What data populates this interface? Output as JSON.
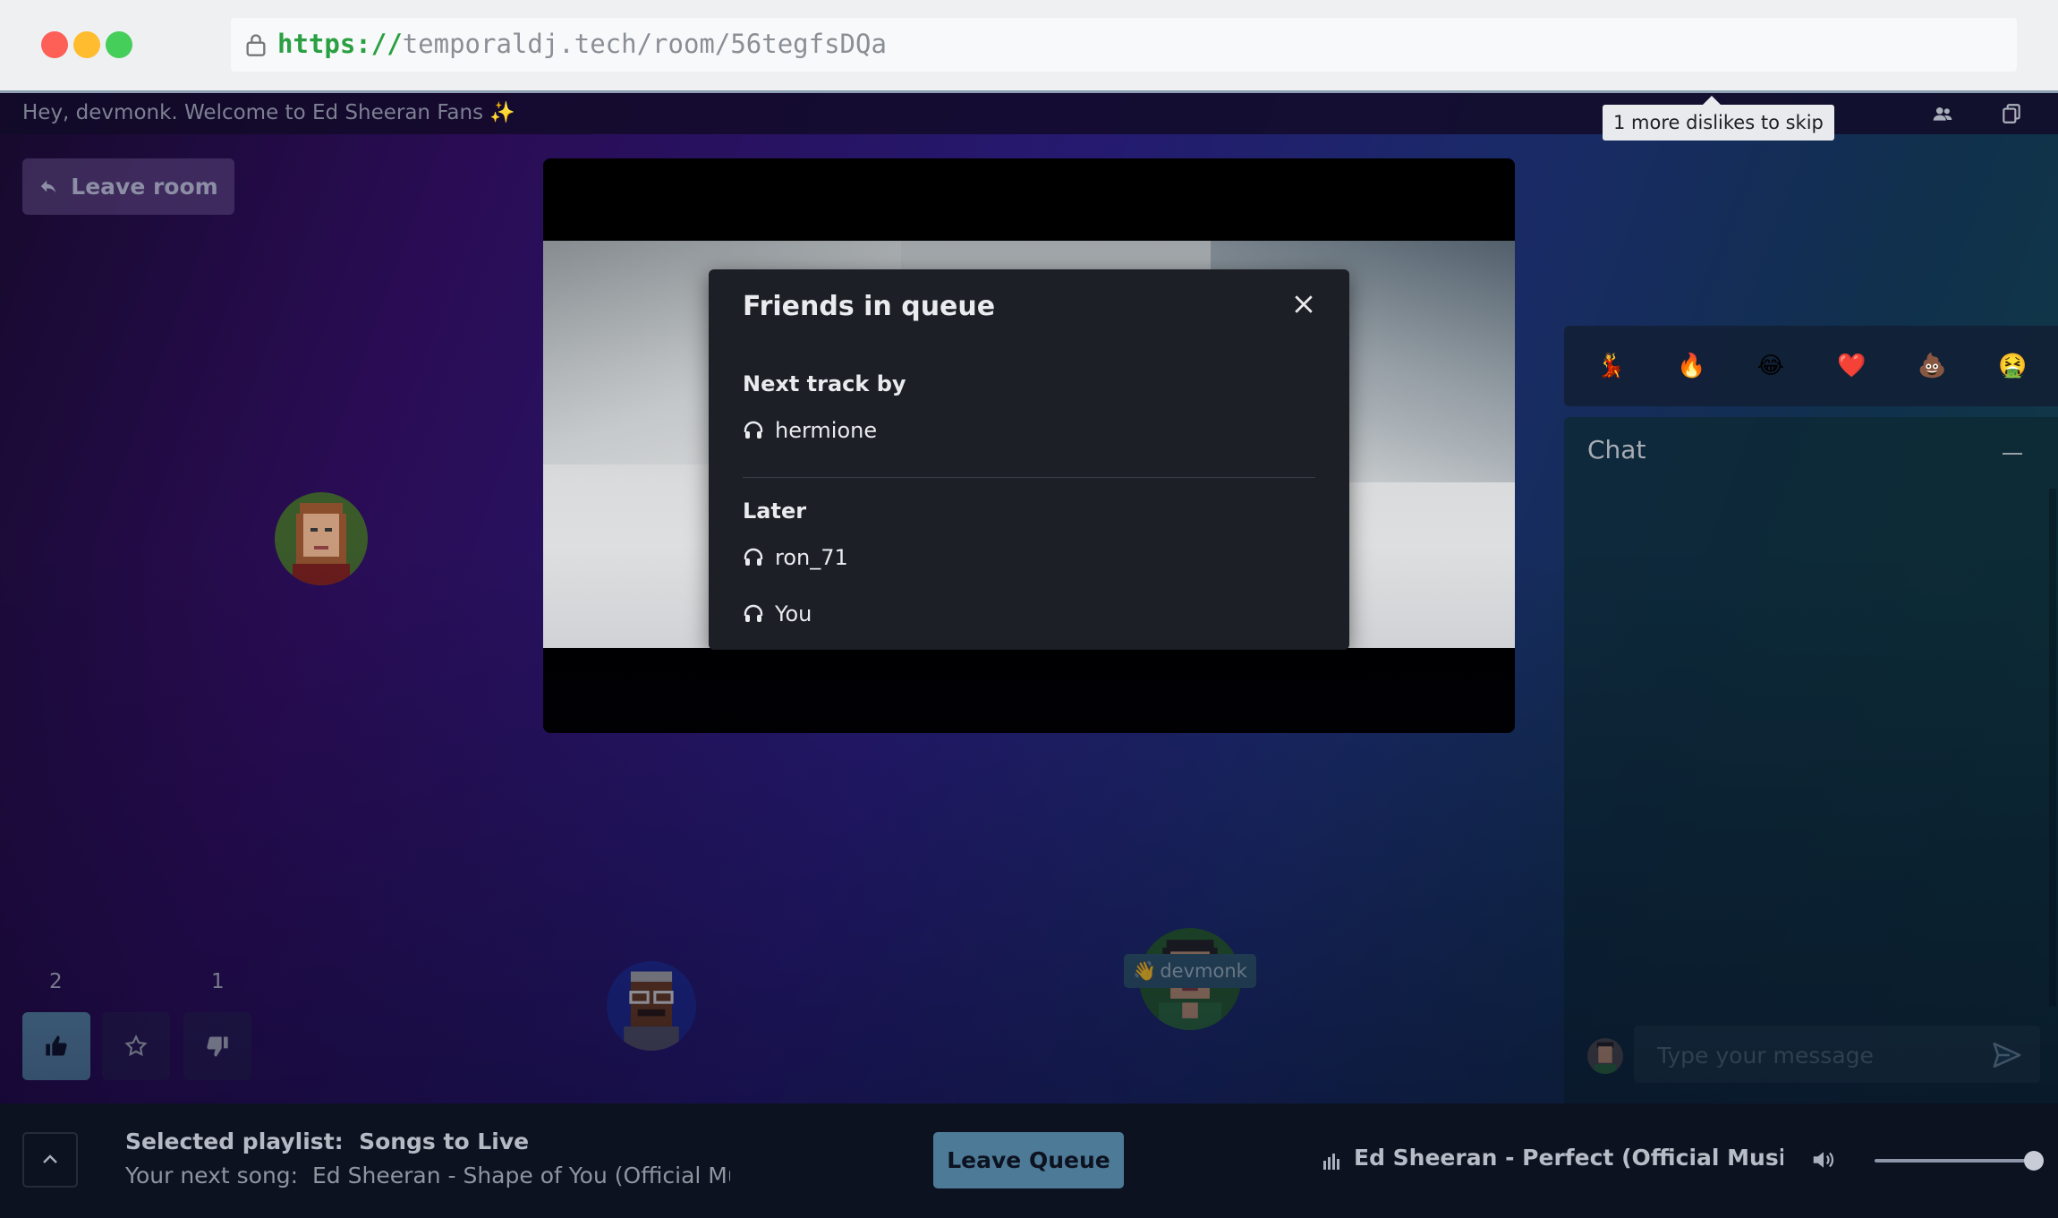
{
  "browser": {
    "url_scheme": "https://",
    "url_rest": "temporaldj.tech/room/56tegfsDQa"
  },
  "topbar": {
    "welcome": "Hey, devmonk. Welcome to Ed Sheeran Fans ✨",
    "tooltip": "1 more dislikes to skip"
  },
  "room": {
    "leave_label": "Leave room"
  },
  "queue_modal": {
    "title": "Friends in queue",
    "next_heading": "Next track by",
    "next_user": "hermione",
    "later_heading": "Later",
    "later_users": [
      "ron_71",
      "You"
    ]
  },
  "users": {
    "self_name": "devmonk",
    "self_prefix": "👋"
  },
  "votes": {
    "like_count": "2",
    "dislike_count": "1"
  },
  "reactions": [
    "💃",
    "🔥",
    "😂",
    "❤️",
    "💩",
    "🤮"
  ],
  "chat": {
    "title": "Chat",
    "placeholder": "Type your message"
  },
  "bottom": {
    "playlist_label": "Selected playlist:",
    "playlist_name": "Songs to Live",
    "next_label": "Your next song:",
    "next_song": "Ed Sheeran - Shape of You (Official Music Video)",
    "leave_queue": "Leave Queue",
    "now_playing": "Ed Sheeran - Perfect (Official Music Video)"
  },
  "colors": {
    "accent": "#4d7a96",
    "like_active": "#5a8aa8"
  }
}
